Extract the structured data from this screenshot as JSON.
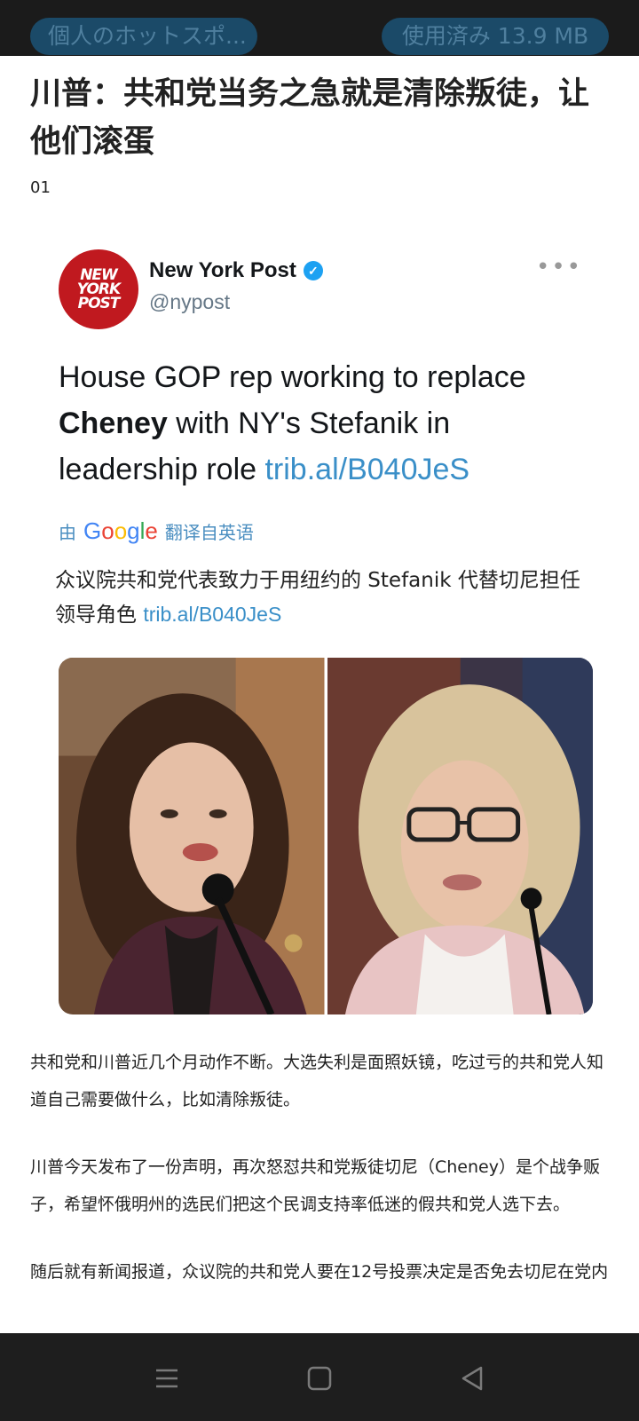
{
  "status_bar": {
    "hotspot_label": "個人のホットスポ...",
    "data_usage": "使用済み 13.9 MB"
  },
  "article": {
    "title": "川普：共和党当务之急就是清除叛徒，让他们滚蛋",
    "section_number": "01",
    "paragraphs": [
      "共和党和川普近几个月动作不断。大选失利是面照妖镜，吃过亏的共和党人知道自己需要做什么，比如清除叛徒。",
      "川普今天发布了一份声明，再次怒怼共和党叛徒切尼（Cheney）是个战争贩子，希望怀俄明州的选民们把这个民调支持率低迷的假共和党人选下去。",
      "随后就有新闻报道，众议院的共和党人要在12号投票决定是否免去切尼在党内"
    ]
  },
  "tweet": {
    "logo_lines": [
      "NEW",
      "YORK",
      "POST"
    ],
    "account_name": "New York Post",
    "handle": "@nypost",
    "text_part1": "House GOP rep working to replace ",
    "text_bold": "Cheney",
    "text_part2": " with NY's Stefanik in leadership role ",
    "link": "trib.al/B040JeS",
    "translate_prefix": "由",
    "translate_brand": "Google",
    "translate_suffix": "翻译自英语",
    "translated_text": "众议院共和党代表致力于用纽约的 Stefanik 代替切尼担任领导角色 ",
    "translated_link": "trib.al/B040JeS",
    "more_icon": "more-dots-icon"
  },
  "nav": {
    "menu_icon": "menu-icon",
    "home_icon": "home-square-icon",
    "back_icon": "back-triangle-icon"
  },
  "colors": {
    "pill_bg": "#1b4a68",
    "pill_text": "#4f7f9e",
    "link": "#3a8fc8",
    "nyp_red": "#c0191f",
    "verified_blue": "#1da1f2"
  }
}
